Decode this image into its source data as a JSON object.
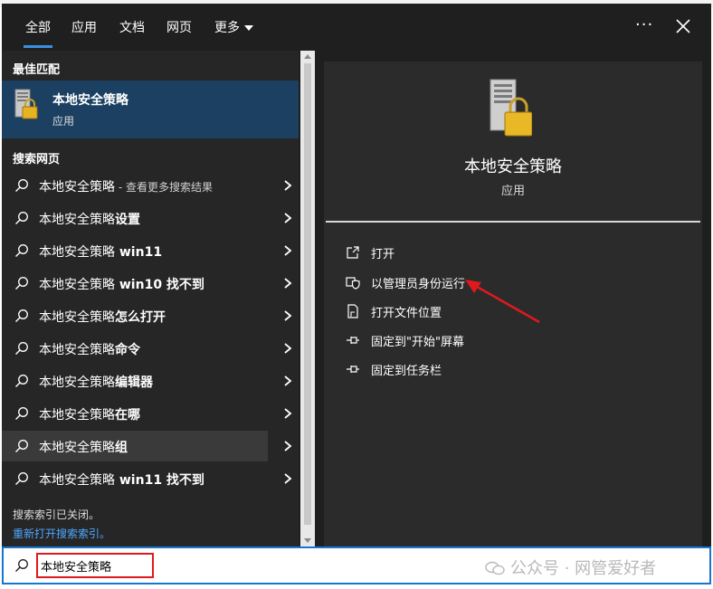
{
  "tabs": [
    {
      "label": "全部"
    },
    {
      "label": "应用"
    },
    {
      "label": "文档"
    },
    {
      "label": "网页"
    },
    {
      "label": "更多"
    }
  ],
  "best_match": {
    "section": "最佳匹配",
    "name": "本地安全策略",
    "type": "应用"
  },
  "web_section": "搜索网页",
  "web_results": [
    {
      "main": "本地安全策略",
      "bold_suffix": "",
      "sub": " - 查看更多搜索结果"
    },
    {
      "main": "本地安全策略",
      "bold_suffix": "设置",
      "sub": ""
    },
    {
      "main": "本地安全策略",
      "bold_suffix": " win11",
      "sub": ""
    },
    {
      "main": "本地安全策略",
      "bold_suffix": " win10 找不到",
      "sub": ""
    },
    {
      "main": "本地安全策略",
      "bold_suffix": "怎么打开",
      "sub": ""
    },
    {
      "main": "本地安全策略",
      "bold_suffix": "命令",
      "sub": ""
    },
    {
      "main": "本地安全策略",
      "bold_suffix": "编辑器",
      "sub": ""
    },
    {
      "main": "本地安全策略",
      "bold_suffix": "在哪",
      "sub": ""
    },
    {
      "main": "本地安全策略",
      "bold_suffix": "组",
      "sub": ""
    },
    {
      "main": "本地安全策略",
      "bold_suffix": " win11 找不到",
      "sub": ""
    }
  ],
  "footer": {
    "note": "搜索索引已关闭。",
    "link": "重新打开搜索索引。"
  },
  "detail": {
    "name": "本地安全策略",
    "type": "应用",
    "actions": [
      {
        "label": "打开",
        "icon": "open-icon"
      },
      {
        "label": "以管理员身份运行",
        "icon": "admin-shield-icon"
      },
      {
        "label": "打开文件位置",
        "icon": "file-location-icon"
      },
      {
        "label": "固定到\"开始\"屏幕",
        "icon": "pin-icon"
      },
      {
        "label": "固定到任务栏",
        "icon": "pin-icon"
      }
    ]
  },
  "search": {
    "value": "本地安全策略"
  },
  "watermark": "公众号 · 网管爱好者",
  "colors": {
    "accent": "#3b8ee0",
    "selected_bg": "#1b4061",
    "annotation_red": "#e0191c"
  }
}
